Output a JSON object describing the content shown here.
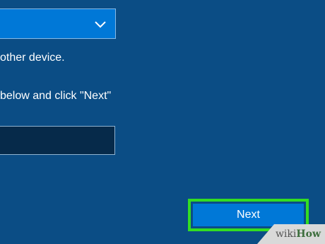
{
  "device_dropdown": {
    "arrow_icon": "chevron-down-icon"
  },
  "instructions": {
    "line1": "other device.",
    "line2": " below and click \"Next\""
  },
  "code_input": {
    "value": ""
  },
  "next_button": {
    "label": "Next",
    "highlight_color": "#33dd22"
  },
  "watermark": {
    "prefix": "wiki",
    "suffix": "How"
  },
  "colors": {
    "background": "#0b4d85",
    "accent": "#0078d7",
    "input_background": "#062a4a"
  }
}
